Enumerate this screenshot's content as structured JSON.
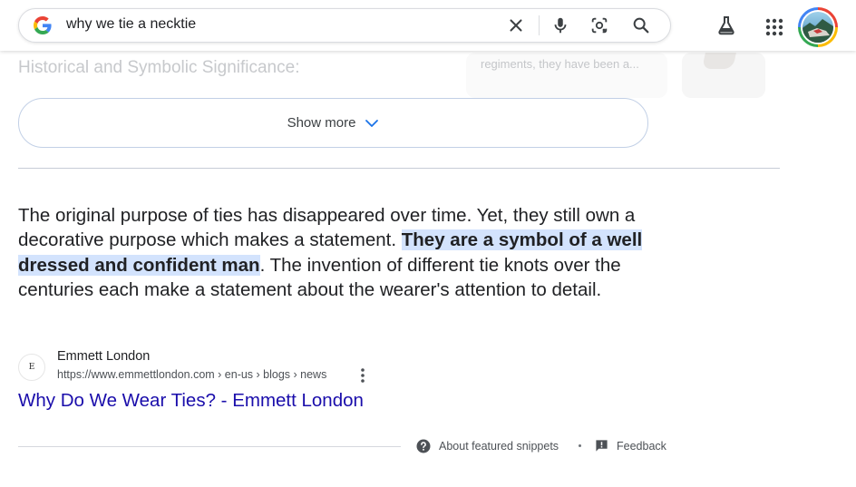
{
  "search": {
    "query": "why we tie a necktie"
  },
  "background": {
    "section_heading": "Historical and Symbolic Significance:",
    "side_snippet": "regiments, they have been a..."
  },
  "show_more": {
    "label": "Show more"
  },
  "snippet": {
    "text_before": "The original purpose of ties has disappeared over time. Yet, they still own a decorative purpose which makes a statement. ",
    "highlight": "They are a symbol of a well dressed and confident man",
    "text_after": ". The invention of different tie knots over the centuries each make a statement about the wearer's attention to detail."
  },
  "source": {
    "favicon_letter": "E",
    "site_name": "Emmett London",
    "url": "https://www.emmettlondon.com › en-us › blogs › news",
    "title": "Why Do We Wear Ties? - Emmett London"
  },
  "footer": {
    "about_label": "About featured snippets",
    "feedback_label": "Feedback"
  },
  "colors": {
    "link": "#1a0dab",
    "highlight": "#d3e3fd",
    "accent_blue": "#1a73e8"
  },
  "icons": [
    "google-logo-icon",
    "clear-icon",
    "microphone-icon",
    "lens-icon",
    "search-icon",
    "labs-flask-icon",
    "apps-grid-icon",
    "chevron-down-icon",
    "more-vert-icon",
    "help-circle-icon",
    "feedback-icon"
  ]
}
